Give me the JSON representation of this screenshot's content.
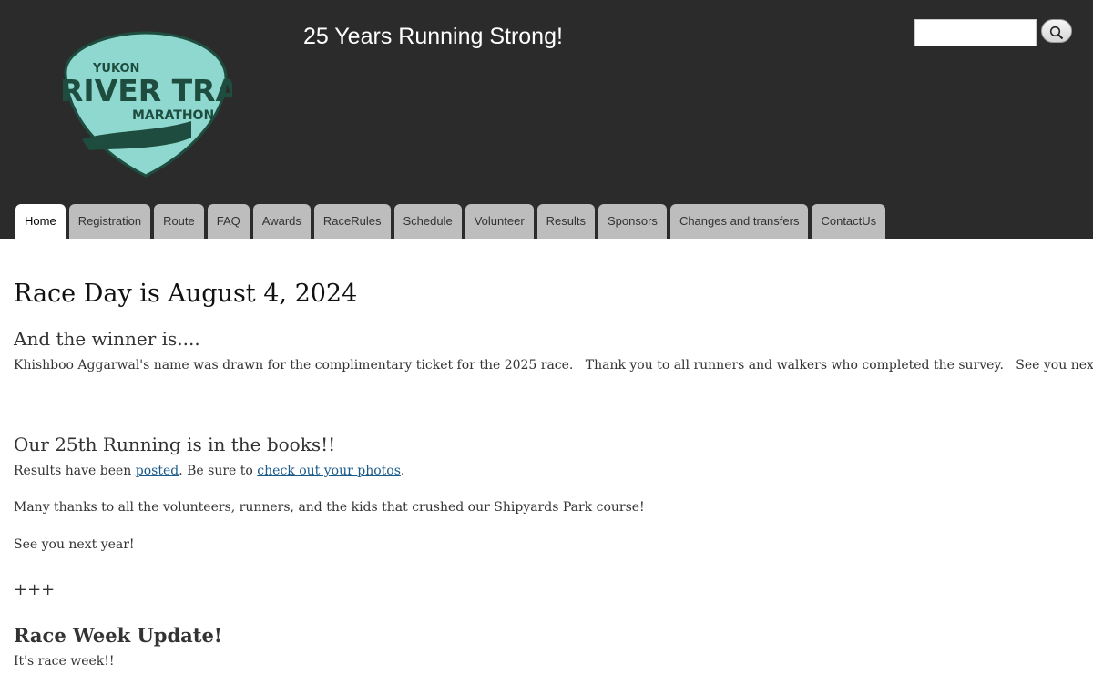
{
  "header": {
    "slogan": "25 Years Running Strong!",
    "logo": {
      "line1": "YUKON",
      "line2": "RIVER TRAIL",
      "line3": "MARATHON",
      "color": "#8fd8cf",
      "dark": "#1e4d3f"
    },
    "search": {
      "value": "",
      "placeholder": "",
      "button_icon": "magnifier-icon"
    }
  },
  "nav": {
    "tabs": [
      {
        "label": "Home",
        "active": true
      },
      {
        "label": "Registration"
      },
      {
        "label": "Route"
      },
      {
        "label": "FAQ"
      },
      {
        "label": "Awards"
      },
      {
        "label": "RaceRules"
      },
      {
        "label": "Schedule"
      },
      {
        "label": "Volunteer"
      },
      {
        "label": "Results"
      },
      {
        "label": "Sponsors"
      },
      {
        "label": "Changes and transfers"
      },
      {
        "label": "ContactUs"
      }
    ]
  },
  "main": {
    "title": "Race Day is August 4, 2024",
    "winner": {
      "heading": "And the winner is....",
      "text": "Khishboo Aggarwal's name was drawn for the complimentary ticket for the 2025 race.   Thank you to all runners and walkers who completed the survey.   See you next year!"
    },
    "running": {
      "heading": "Our 25th Running is in the books!!",
      "results_prefix": "Results have been ",
      "results_link": "posted",
      "results_middle": ". Be sure to ",
      "photos_link": "check out your photos",
      "results_suffix": ".",
      "thanks": "Many thanks to all the volunteers, runners, and the kids that crushed our Shipyards Park course!",
      "see_you": "See you next year!"
    },
    "separator": "+++",
    "update": {
      "heading": "Race Week Update!",
      "text": "It's race week!!"
    }
  },
  "colors": {
    "header_bg": "#2b2b2b",
    "tab_bg": "#bdbdbd",
    "link": "#1a5a8a"
  }
}
